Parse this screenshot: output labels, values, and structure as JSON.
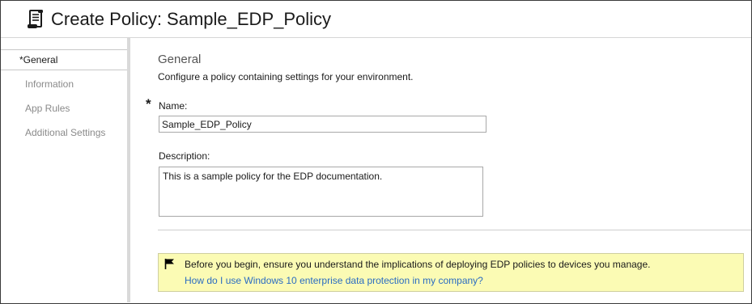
{
  "header": {
    "icon": "scroll-policy-icon",
    "title": "Create Policy: Sample_EDP_Policy"
  },
  "sidebar": {
    "items": [
      {
        "label": "*General",
        "active": true
      },
      {
        "label": "Information",
        "active": false
      },
      {
        "label": "App Rules",
        "active": false
      },
      {
        "label": "Additional Settings",
        "active": false
      }
    ]
  },
  "main": {
    "section_title": "General",
    "section_description": "Configure a policy containing settings for your environment.",
    "required_marker": "*",
    "name": {
      "label": "Name:",
      "value": "Sample_EDP_Policy"
    },
    "description": {
      "label": "Description:",
      "value": "This is a sample policy for the EDP documentation."
    }
  },
  "notice": {
    "icon": "flag-icon",
    "message": "Before you begin, ensure you understand the implications of deploying EDP policies to devices you manage.",
    "link_text": "How do I use Windows 10 enterprise data protection in my company?",
    "background_color": "#fbfbb4",
    "link_color": "#2a6cc2"
  }
}
